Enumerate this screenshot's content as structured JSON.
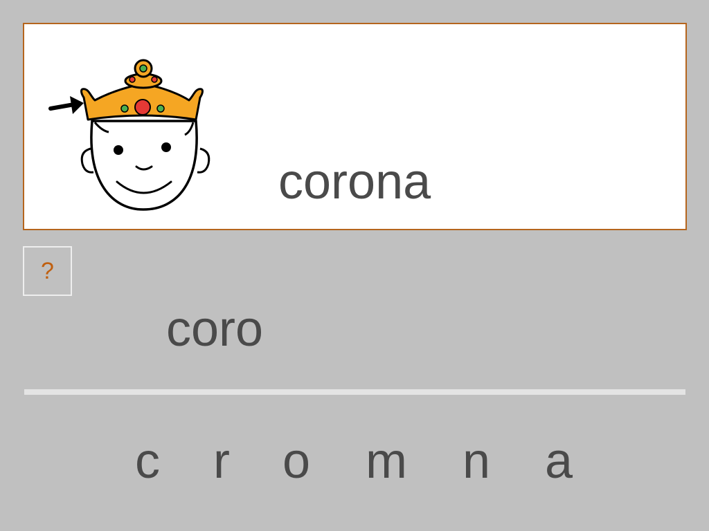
{
  "target": {
    "word": "corona",
    "pictogram": "king-with-crown-icon"
  },
  "hint": {
    "label": "?"
  },
  "answer": {
    "current": "coro"
  },
  "letters": [
    "c",
    "r",
    "o",
    "m",
    "n",
    "a"
  ],
  "colors": {
    "background": "#c0c0c0",
    "card_border": "#b5651d",
    "text": "#4a4a4a",
    "hint_text": "#c06010",
    "crown": "#f5a623"
  }
}
